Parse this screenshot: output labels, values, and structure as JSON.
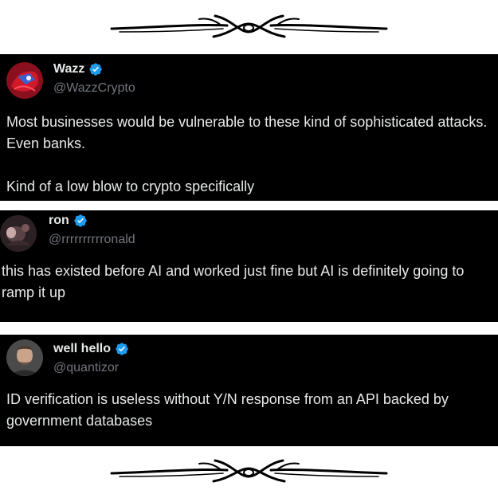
{
  "colors": {
    "card_background": "#000000",
    "text_primary": "#e7e9ea",
    "text_secondary": "#71767b",
    "verified_badge": "#1d9bf0",
    "page_background": "#ffffff"
  },
  "ornaments": {
    "icon": "decorative-flourish-icon"
  },
  "tweets": [
    {
      "display_name": "Wazz",
      "handle": "@WazzCrypto",
      "verified": true,
      "text": "Most businesses would be vulnerable to these kind of sophisticated attacks. Even banks.\n\nKind of a low blow to crypto specifically"
    },
    {
      "display_name": "ron",
      "handle": "@rrrrrrrrrronald",
      "verified": true,
      "text": "this has existed before AI and worked just fine but AI is definitely going to ramp it up"
    },
    {
      "display_name": "well hello",
      "handle": "@quantizor",
      "verified": true,
      "text": "ID verification is useless without Y/N response from an API backed by government databases"
    }
  ]
}
